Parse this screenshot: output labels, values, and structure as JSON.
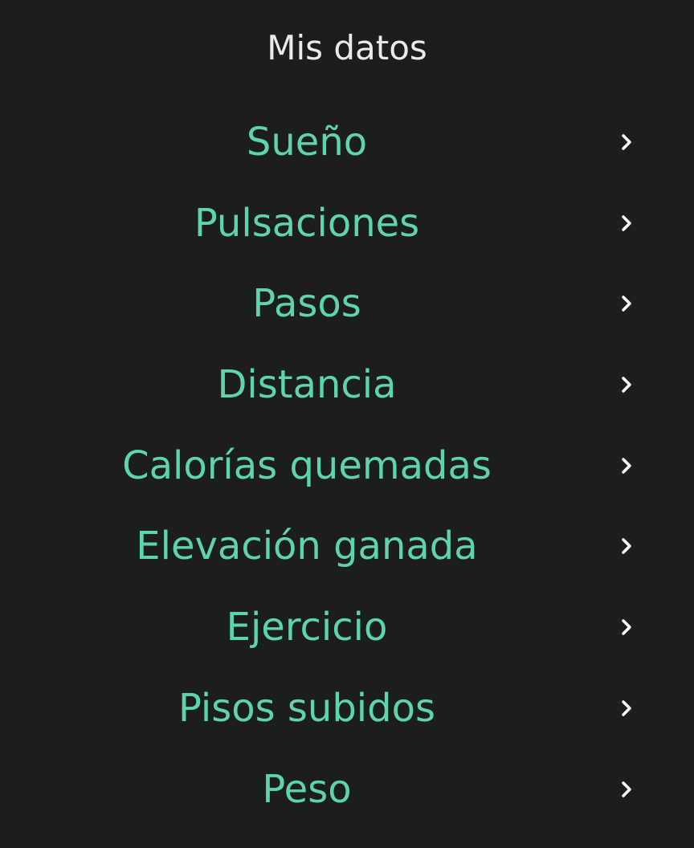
{
  "header": {
    "title": "Mis datos"
  },
  "colors": {
    "background": "#1c1d1d",
    "title": "#eaeaea",
    "item_text": "#5ed5a8",
    "chevron": "#ffffff"
  },
  "menu": {
    "items": [
      {
        "label": "Sueño",
        "icon": "chevron-right-icon"
      },
      {
        "label": "Pulsaciones",
        "icon": "chevron-right-icon"
      },
      {
        "label": "Pasos",
        "icon": "chevron-right-icon"
      },
      {
        "label": "Distancia",
        "icon": "chevron-right-icon"
      },
      {
        "label": "Calorías quemadas",
        "icon": "chevron-right-icon"
      },
      {
        "label": "Elevación ganada",
        "icon": "chevron-right-icon"
      },
      {
        "label": "Ejercicio",
        "icon": "chevron-right-icon"
      },
      {
        "label": "Pisos subidos",
        "icon": "chevron-right-icon"
      },
      {
        "label": "Peso",
        "icon": "chevron-right-icon"
      }
    ]
  }
}
